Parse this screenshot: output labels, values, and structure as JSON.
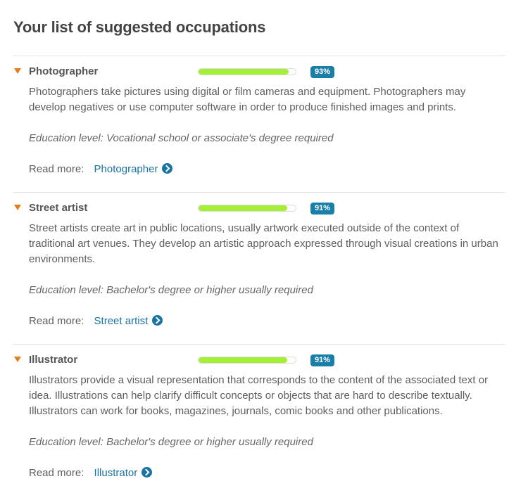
{
  "page": {
    "title": "Your list of suggested occupations"
  },
  "occupations": [
    {
      "name": "Photographer",
      "match_percent": 93,
      "match_label": "93%",
      "description": "Photographers take pictures using digital or film cameras and equipment. Photographers may develop negatives or use computer software in order to produce finished images and prints.",
      "education": "Education level: Vocational school or associate's degree required",
      "read_more_label": "Read more:",
      "read_more_link": "Photographer"
    },
    {
      "name": "Street artist",
      "match_percent": 91,
      "match_label": "91%",
      "description": "Street artists create art in public locations, usually artwork executed outside of the context of traditional art venues. They develop an artistic approach expressed through visual creations in urban environments.",
      "education": "Education level: Bachelor's degree or higher usually required",
      "read_more_label": "Read more:",
      "read_more_link": "Street artist"
    },
    {
      "name": "Illustrator",
      "match_percent": 91,
      "match_label": "91%",
      "description": "Illustrators provide a visual representation that corresponds to the content of the associated text or idea. Illustrations can help clarify difficult concepts or objects that are hard to describe textually. Illustrators can work for books, magazines, journals, comic books and other publications.",
      "education": "Education level: Bachelor's degree or higher usually required",
      "read_more_label": "Read more:",
      "read_more_link": "Illustrator"
    }
  ],
  "colors": {
    "toggle": "#e07f1b",
    "bar_fill": "#a6ef39",
    "badge": "#1a7fa8",
    "link": "#1a73a4"
  },
  "icons": {
    "toggle": "triangle-down-icon",
    "read_more": "chevron-circle-right-icon"
  }
}
